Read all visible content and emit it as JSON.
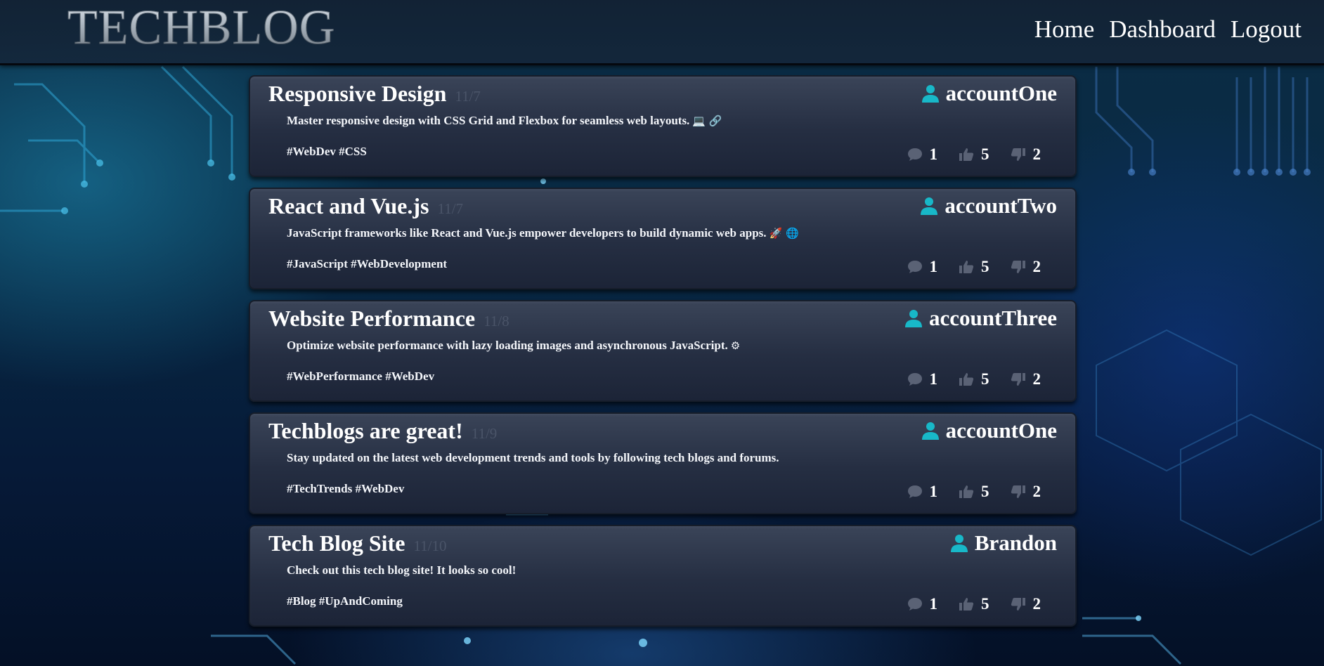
{
  "app": {
    "title": "TECHBLOG"
  },
  "nav": {
    "home": "Home",
    "dashboard": "Dashboard",
    "logout": "Logout"
  },
  "colors": {
    "accent": "#18b8c8",
    "card": "#252e42",
    "icon_muted": "#5a6275"
  },
  "posts": [
    {
      "title": "Responsive Design",
      "date": "11/7",
      "author": "accountOne",
      "body": "Master responsive design with CSS Grid and Flexbox for seamless web layouts.",
      "emoji": "💻 🔗",
      "tags": "#WebDev #CSS",
      "comments": "1",
      "likes": "5",
      "dislikes": "2"
    },
    {
      "title": "React and Vue.js",
      "date": "11/7",
      "author": "accountTwo",
      "body": "JavaScript frameworks like React and Vue.js empower developers to build dynamic web apps.",
      "emoji": "🚀 🌐",
      "tags": "#JavaScript #WebDevelopment",
      "comments": "1",
      "likes": "5",
      "dislikes": "2"
    },
    {
      "title": "Website Performance",
      "date": "11/8",
      "author": "accountThree",
      "body": "Optimize website performance with lazy loading images and asynchronous JavaScript.",
      "emoji": "⚙",
      "tags": "#WebPerformance #WebDev",
      "comments": "1",
      "likes": "5",
      "dislikes": "2"
    },
    {
      "title": "Techblogs are great!",
      "date": "11/9",
      "author": "accountOne",
      "body": "Stay updated on the latest web development trends and tools by following tech blogs and forums.",
      "emoji": "",
      "tags": "#TechTrends #WebDev",
      "comments": "1",
      "likes": "5",
      "dislikes": "2"
    },
    {
      "title": "Tech Blog Site",
      "date": "11/10",
      "author": "Brandon",
      "body": "Check out this tech blog site! It looks so cool!",
      "emoji": "",
      "tags": "#Blog #UpAndComing",
      "comments": "1",
      "likes": "5",
      "dislikes": "2"
    }
  ]
}
